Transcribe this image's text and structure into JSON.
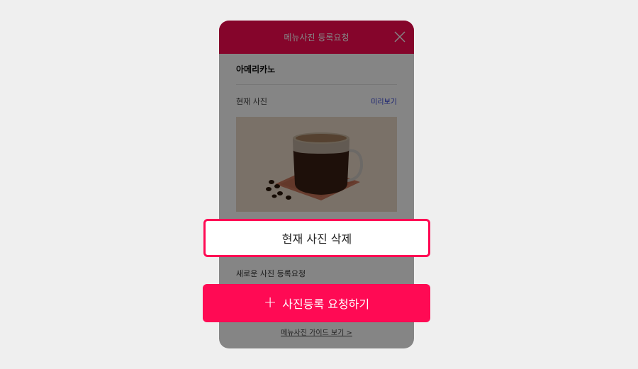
{
  "modal": {
    "title": "메뉴사진 등록요청",
    "menu_name": "아메리카노",
    "current_photo_label": "현재 사진",
    "preview_link": "미리보기",
    "new_request_label": "새로운 사진 등록요청",
    "guide_link": "메뉴사진 가이드 보기 >"
  },
  "actions": {
    "delete_label": "현재 사진 삭제",
    "register_label": "사진등록 요청하기",
    "register_icon": "plus-icon"
  },
  "colors": {
    "accent": "#ff0a54",
    "link": "#2b3bd6",
    "backdrop": "#efefef"
  }
}
